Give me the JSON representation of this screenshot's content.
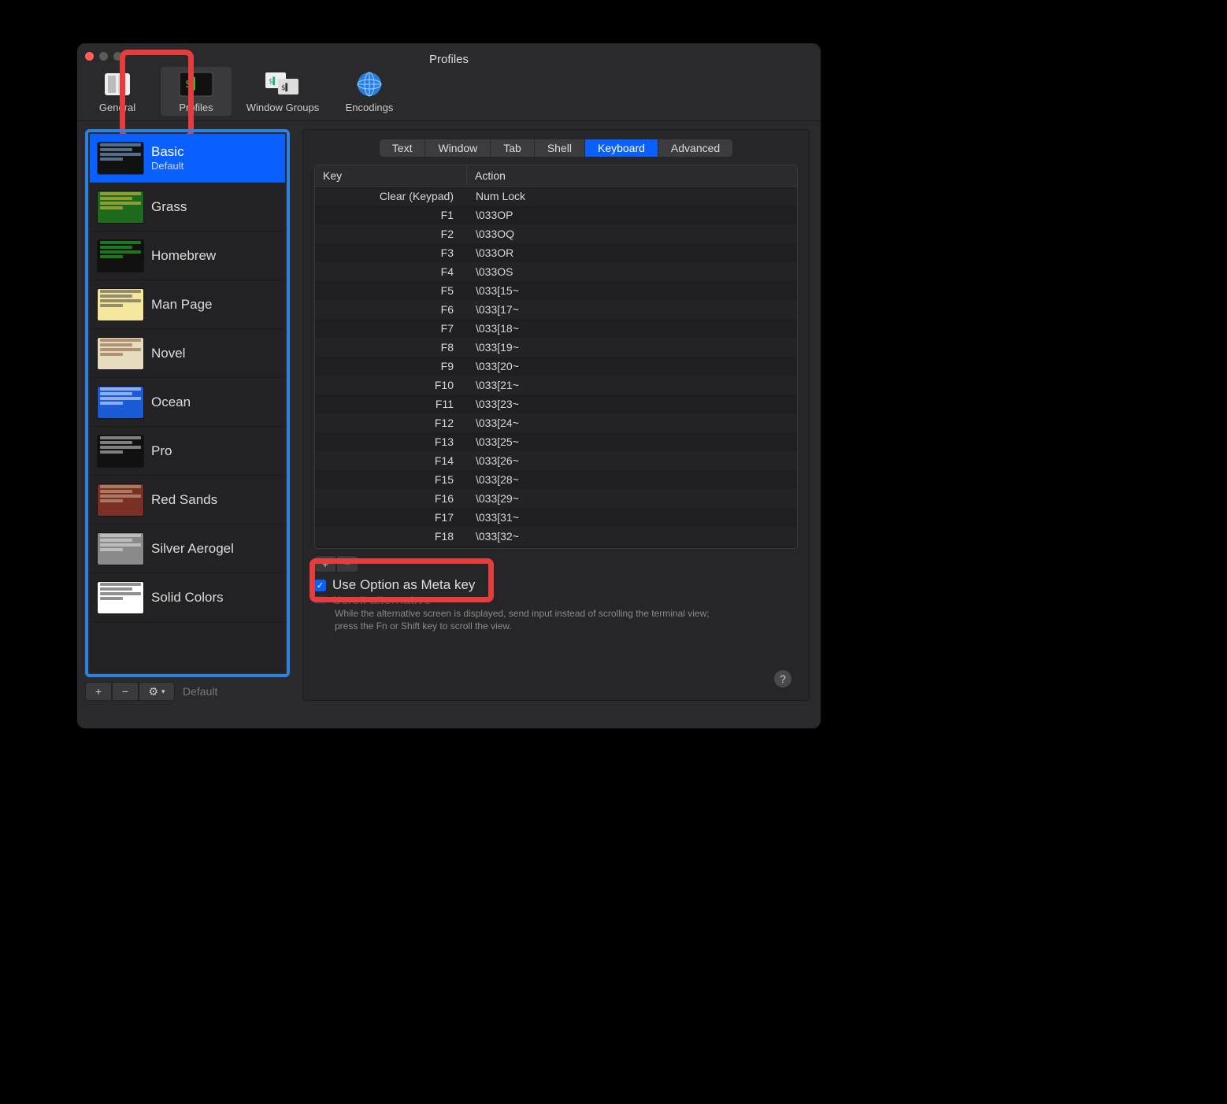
{
  "window": {
    "title": "Profiles"
  },
  "toolbar": {
    "items": [
      {
        "label": "General"
      },
      {
        "label": "Profiles"
      },
      {
        "label": "Window Groups"
      },
      {
        "label": "Encodings"
      }
    ]
  },
  "profiles": [
    {
      "name": "Basic",
      "sub": "Default",
      "selected": true,
      "bg": "#111",
      "fg": "#9cf"
    },
    {
      "name": "Grass",
      "bg": "#1e6b1e",
      "fg": "#ffcf4a"
    },
    {
      "name": "Homebrew",
      "bg": "#111",
      "fg": "#2bde2b"
    },
    {
      "name": "Man Page",
      "bg": "#f5e79e",
      "fg": "#333"
    },
    {
      "name": "Novel",
      "bg": "#e6dcc0",
      "fg": "#7a4a2a"
    },
    {
      "name": "Ocean",
      "bg": "#1c5bd6",
      "fg": "#fff"
    },
    {
      "name": "Pro",
      "bg": "#111",
      "fg": "#eee"
    },
    {
      "name": "Red Sands",
      "bg": "#7a3024",
      "fg": "#d8c49a"
    },
    {
      "name": "Silver Aerogel",
      "bg": "#8a8a8a",
      "fg": "#eee"
    },
    {
      "name": "Solid Colors",
      "bg": "#fff",
      "fg": "#222"
    }
  ],
  "sidebarFooter": {
    "add": "+",
    "remove": "−",
    "default": "Default"
  },
  "tabs": [
    "Text",
    "Window",
    "Tab",
    "Shell",
    "Keyboard",
    "Advanced"
  ],
  "activeTab": "Keyboard",
  "keytable": {
    "headers": {
      "key": "Key",
      "action": "Action"
    },
    "rows": [
      {
        "key": "Clear (Keypad)",
        "action": "Num Lock"
      },
      {
        "key": "F1",
        "action": "\\033OP"
      },
      {
        "key": "F2",
        "action": "\\033OQ"
      },
      {
        "key": "F3",
        "action": "\\033OR"
      },
      {
        "key": "F4",
        "action": "\\033OS"
      },
      {
        "key": "F5",
        "action": "\\033[15~"
      },
      {
        "key": "F6",
        "action": "\\033[17~"
      },
      {
        "key": "F7",
        "action": "\\033[18~"
      },
      {
        "key": "F8",
        "action": "\\033[19~"
      },
      {
        "key": "F9",
        "action": "\\033[20~"
      },
      {
        "key": "F10",
        "action": "\\033[21~"
      },
      {
        "key": "F11",
        "action": "\\033[23~"
      },
      {
        "key": "F12",
        "action": "\\033[24~"
      },
      {
        "key": "F13",
        "action": "\\033[25~"
      },
      {
        "key": "F14",
        "action": "\\033[26~"
      },
      {
        "key": "F15",
        "action": "\\033[28~"
      },
      {
        "key": "F16",
        "action": "\\033[29~"
      },
      {
        "key": "F17",
        "action": "\\033[31~"
      },
      {
        "key": "F18",
        "action": "\\033[32~"
      }
    ]
  },
  "below": {
    "add": "+",
    "remove": "−",
    "option_meta": "Use Option as Meta key",
    "scroll_alt": "Scroll alternative",
    "help": "While the alternative screen is displayed, send input instead of scrolling the terminal view; press the Fn or Shift key to scroll the view."
  },
  "helpbtn": "?"
}
